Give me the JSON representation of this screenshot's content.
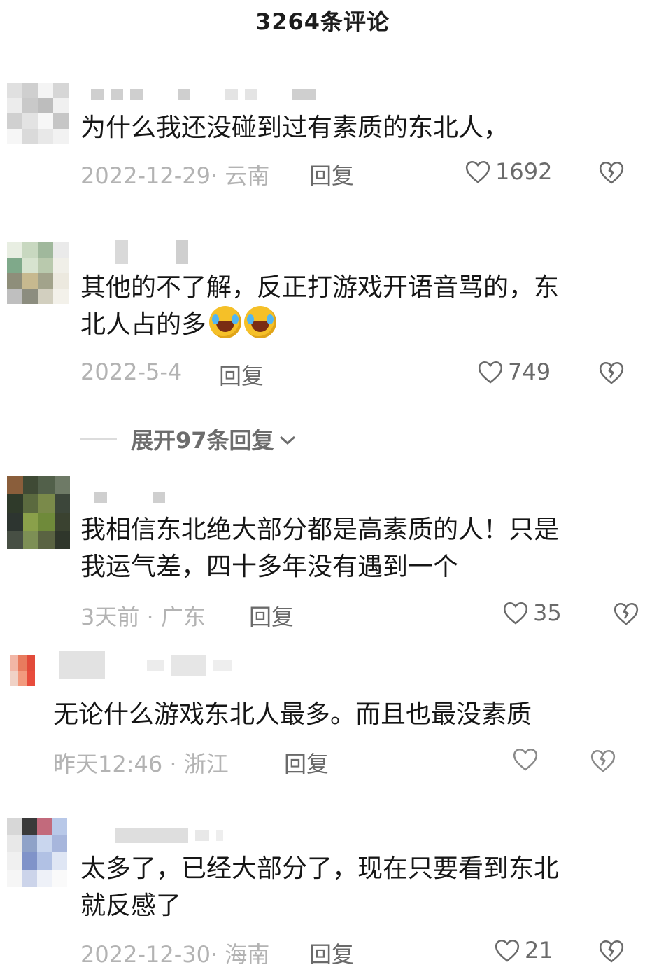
{
  "header": {
    "title": "3264条评论"
  },
  "comments": [
    {
      "text": "为什么我还没碰到过有素质的东北人，",
      "meta": "2022-12-29· 云南",
      "reply": "回复",
      "likes": "1692",
      "avatar_colors": [
        "#e0e0e0",
        "#cfcfcf",
        "#f4f4f4",
        "#d6d6d6",
        "#ececec",
        "#c9c9c9",
        "#bdbdbd",
        "#f0f0f0",
        "#d0d0d0",
        "#e3e3e3",
        "#f7f7f7",
        "#c6c6c6",
        "#f6f6f6",
        "#dadada",
        "#e8e8e8",
        "#f2f2f2"
      ]
    },
    {
      "text": "其他的不了解，反正打游戏开语音骂的，东\n北人占的多",
      "emoji": [
        "face-with-tears-of-joy-icon",
        "face-with-tears-of-joy-icon"
      ],
      "meta": "2022-5-4",
      "reply": "回复",
      "likes": "749",
      "expand_label": "展开97条回复",
      "avatar_colors": [
        "#e8eee2",
        "#c8d8c0",
        "#a0b89c",
        "#eaeaea",
        "#7fa98a",
        "#d7e3cf",
        "#b9c9ad",
        "#f0efe8",
        "#8e8e7a",
        "#c7b98f",
        "#a2a38b",
        "#ece9df",
        "#bfbfbf",
        "#8c8d7f",
        "#d2cfbf",
        "#f3f1ea"
      ]
    },
    {
      "text": "我相信东北绝大部分都是高素质的人！只是\n我运气差，四十多年没有遇到一个",
      "meta": "3天前 · 广东",
      "reply": "回复",
      "likes": "35",
      "avatar_colors": [
        "#8a5e3b",
        "#3f4a35",
        "#52604a",
        "#6e7a66",
        "#2f3a2a",
        "#5b6a3f",
        "#7a8a4a",
        "#3c463a",
        "#2d3530",
        "#8aa04a",
        "#6f8a3a",
        "#3a4230",
        "#474f44",
        "#7d8f55",
        "#5a6342",
        "#2f362b"
      ]
    },
    {
      "text": "无论什么游戏东北人最多。而且也最没素质",
      "meta": "昨天12:46 · 浙江",
      "reply": "回复",
      "likes": "",
      "avatar_colors": [
        "#f2b6a6",
        "#e87b5e",
        "#e24a3a",
        "#ffffff",
        "#f0d2c6",
        "#f29a7e",
        "#e84c3c",
        "#ffffff"
      ]
    },
    {
      "text": "太多了，已经大部分了，现在只要看到东北\n就反感了",
      "meta": "2022-12-30· 海南",
      "reply": "回复",
      "likes": "21",
      "avatar_colors": [
        "#d7d7d7",
        "#3a3a3a",
        "#c26a7c",
        "#b8c8e8",
        "#e8e8e8",
        "#8fa2c8",
        "#c9d6ee",
        "#a7b6dc",
        "#f0f0f0",
        "#8093c9",
        "#b1c1e4",
        "#dfe6f4",
        "#f6f6f6",
        "#ccd4ea",
        "#eef1f8",
        "#fafafa"
      ]
    }
  ]
}
